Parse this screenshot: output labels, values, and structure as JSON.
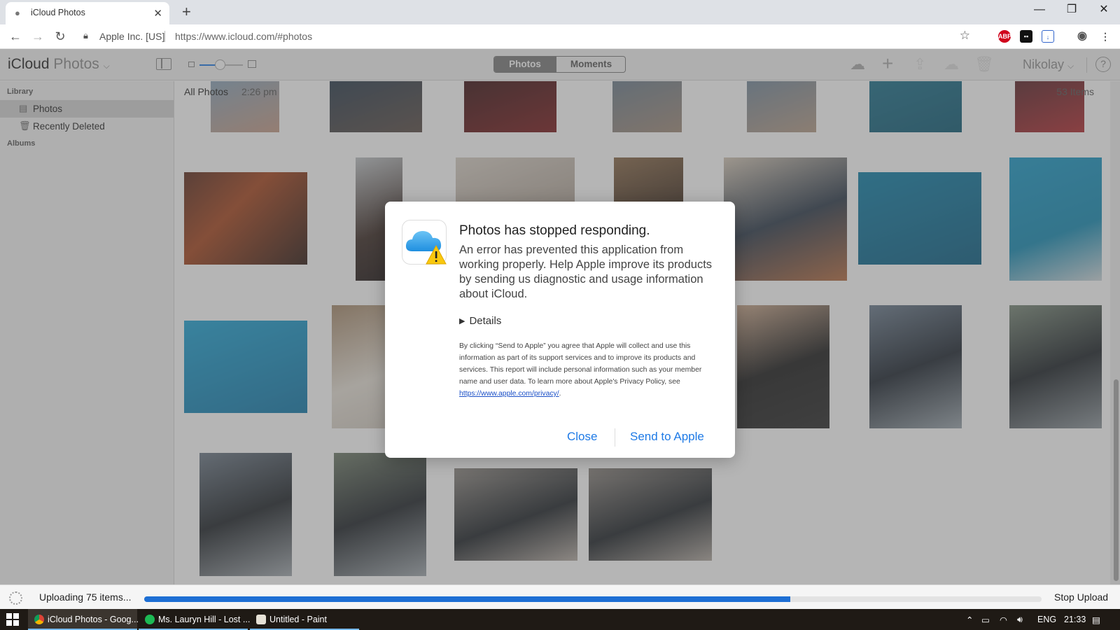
{
  "browser": {
    "tab_title": "iCloud Photos",
    "site_identity": "Apple Inc. [US]",
    "url": "https://www.icloud.com/#photos",
    "ext_abp": "ABP"
  },
  "app": {
    "brand": "iCloud",
    "section": "Photos",
    "segments": [
      "Photos",
      "Moments"
    ],
    "user": "Nikolay",
    "help": "?"
  },
  "sidebar": {
    "library_heading": "Library",
    "items": [
      {
        "label": "Photos",
        "icon": "photos-icon"
      },
      {
        "label": "Recently Deleted",
        "icon": "trash-icon"
      }
    ],
    "albums_heading": "Albums"
  },
  "main": {
    "title": "All Photos",
    "time": "2:26 pm",
    "count": "53 Items"
  },
  "dialog": {
    "title": "Photos has stopped responding.",
    "message": "An error has prevented this application from working properly. Help Apple improve its products by sending us diagnostic and usage information about iCloud.",
    "details": "Details",
    "fine_print": "By clicking “Send to Apple” you agree that Apple will collect and use this information as part of its support services and to improve its products and services. This report will include personal information such as your member name and user data. To learn more about Apple's Privacy Policy, see ",
    "privacy_link": "https://www.apple.com/privacy/",
    "close_label": "Close",
    "send_label": "Send to Apple"
  },
  "upload": {
    "status": "Uploading 75 items...",
    "progress": 0.72,
    "stop_label": "Stop Upload"
  },
  "taskbar": {
    "apps": [
      "iCloud Photos - Goog...",
      "Ms. Lauryn Hill - Lost ...",
      "Untitled - Paint"
    ],
    "lang": "ENG",
    "clock": "21:33"
  },
  "colors": {
    "accent": "#1e7ae6",
    "progress": "#1e6fd4",
    "segment_active": "#7a7a7a"
  }
}
